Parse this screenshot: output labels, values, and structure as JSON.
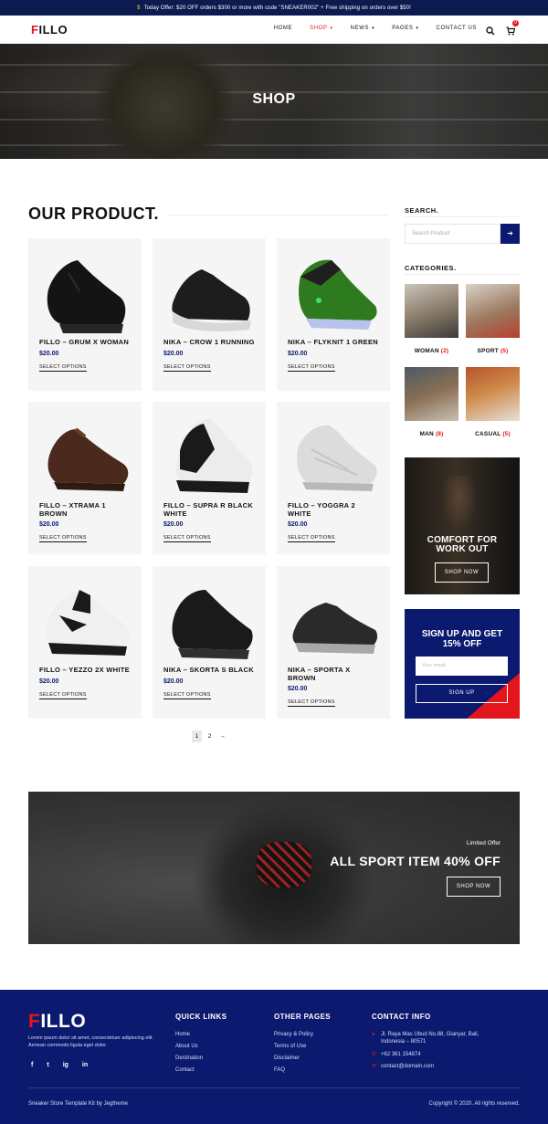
{
  "topbar": {
    "icon": "$",
    "text": "Today Offer: $20 OFF orders $300 or more with code \"SNEAKER002\" + Free shipping on orders over $50!"
  },
  "brand": {
    "logo_first": "F",
    "logo_rest": "ILLO",
    "accent": "#e3151d",
    "navy": "#0b1a6f"
  },
  "nav": {
    "items": [
      "HOME",
      "SHOP",
      "NEWS",
      "PAGES",
      "CONTACT US"
    ],
    "active": "SHOP",
    "cart_count": "0"
  },
  "hero": {
    "title": "SHOP"
  },
  "products_section": {
    "title": "OUR PRODUCT."
  },
  "products": [
    {
      "name": "FILLO – GRUM X WOMAN",
      "price": "$20.00",
      "action": "SELECT OPTIONS"
    },
    {
      "name": "NIKA – CROW 1 RUNNING",
      "price": "$20.00",
      "action": "SELECT OPTIONS"
    },
    {
      "name": "NIKA – FLYKNIT 1 GREEN",
      "price": "$20.00",
      "action": "SELECT OPTIONS"
    },
    {
      "name": "FILLO – XTRAMA 1 BROWN",
      "price": "$20.00",
      "action": "SELECT OPTIONS"
    },
    {
      "name": "FILLO – SUPRA R BLACK WHITE",
      "price": "$20.00",
      "action": "SELECT OPTIONS"
    },
    {
      "name": "FILLO – YOGGRA 2 WHITE",
      "price": "$20.00",
      "action": "SELECT OPTIONS"
    },
    {
      "name": "FILLO – YEZZO 2X WHITE",
      "price": "$20.00",
      "action": "SELECT OPTIONS"
    },
    {
      "name": "NIKA – SKORTA S BLACK",
      "price": "$20.00",
      "action": "SELECT OPTIONS"
    },
    {
      "name": "NIKA – SPORTA X BROWN",
      "price": "$20.00",
      "action": "SELECT OPTIONS"
    }
  ],
  "pagination": {
    "pages": [
      "1",
      "2"
    ],
    "current": "1",
    "next": "→"
  },
  "sidebar": {
    "search_title": "SEARCH.",
    "search_placeholder": "Search Product",
    "categories_title": "CATEGORIES.",
    "categories": [
      {
        "label": "WOMAN",
        "count": "(2)"
      },
      {
        "label": "SPORT",
        "count": "(5)"
      },
      {
        "label": "MAN",
        "count": "(8)"
      },
      {
        "label": "CASUAL",
        "count": "(5)"
      }
    ],
    "promo": {
      "title_line1": "COMFORT FOR",
      "title_line2": "WORK OUT",
      "button": "SHOP NOW"
    },
    "signup": {
      "title_line1": "SIGN UP AND GET",
      "title_line2": "15% OFF",
      "placeholder": "Your email",
      "button": "SIGN UP"
    }
  },
  "banner": {
    "small": "Limited Offer",
    "title": "ALL SPORT ITEM 40% OFF",
    "button": "SHOP NOW"
  },
  "footer": {
    "description": "Lorem ipsum dolor sit amet, consectetuer adipiscing elit. Aenean commodo ligula eget dolor.",
    "social": [
      "f",
      "t",
      "ig",
      "in"
    ],
    "quick_links_title": "QUICK LINKS",
    "quick_links": [
      "Home",
      "About Us",
      "Destination",
      "Contact"
    ],
    "other_pages_title": "OTHER PAGES",
    "other_pages": [
      "Privacy & Policy",
      "Terms of Use",
      "Disclaimer",
      "FAQ"
    ],
    "contact_title": "CONTACT INFO",
    "address": "Jl. Raya Mas Ubud No.88, Gianyar, Bali, Indonesia – 80571",
    "phone": "+62 361 154874",
    "email": "contact@domain.com",
    "credit": "Sneaker Store Template Kit by Jegtheme",
    "copyright": "Copyright © 2020. All rights reserved."
  }
}
